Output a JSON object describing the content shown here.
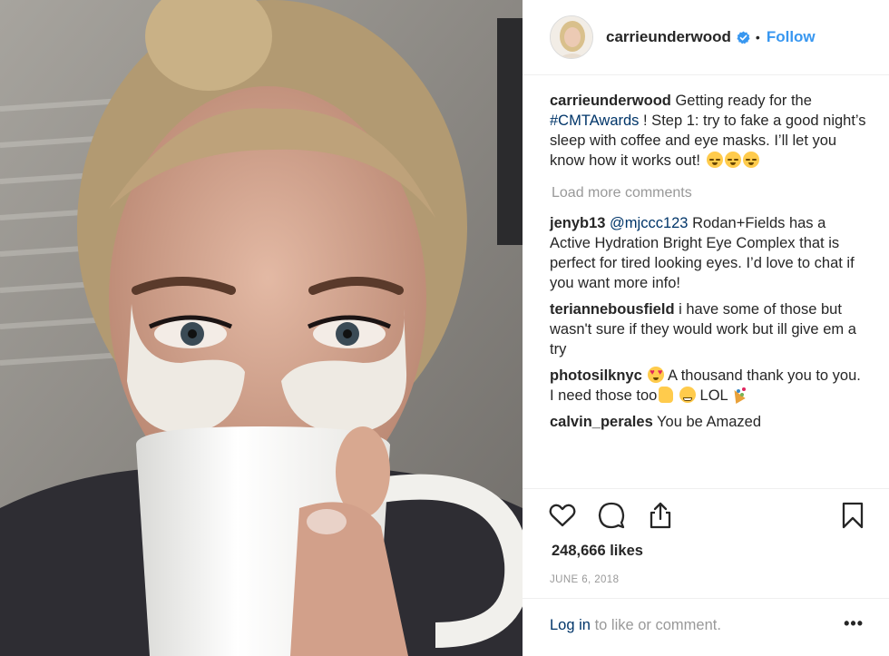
{
  "post": {
    "photo_description": "photo",
    "author": {
      "username": "carrieunderwood",
      "verified": true,
      "separator": "•",
      "follow_label": "Follow"
    },
    "caption": {
      "user": "carrieunderwood",
      "text_before": "Getting ready for the",
      "hashtag": "#CMTAwards",
      "text_after": "! Step 1: try to fake a good night’s sleep with coffee and eye masks. I’ll let you know how it works out!",
      "emojis": [
        "sleeping-face",
        "sleeping-face",
        "sleeping-face"
      ]
    },
    "load_more_label": "Load more comments",
    "comments": [
      {
        "user": "jenyb13",
        "mention": "@mjccc123",
        "text": "Rodan+Fields has a Active Hydration Bright Eye Complex that is perfect for tired looking eyes. I’d love to chat if you want more info!"
      },
      {
        "user": "teriannebousfield",
        "text": "i have some of those but wasn't sure if they would work but ill give em a try"
      },
      {
        "user": "photosilknyc",
        "emoji_before": "heart-eyes",
        "text": "A thousand thank you to you. I need those too",
        "emoji_mid": [
          "thumbs-up",
          "grinning-face"
        ],
        "text_after": "LOL",
        "emoji_after": "party-popper"
      },
      {
        "user": "calvin_perales",
        "text": "You be Amazed"
      }
    ],
    "likes_label": "248,666 likes",
    "date_label": "JUNE 6, 2018",
    "login": {
      "link_label": "Log in",
      "rest_label": "to like or comment.",
      "more_label": "•••"
    },
    "icons": {
      "like": "heart-icon",
      "comment": "comment-bubble-icon",
      "share": "share-icon",
      "save": "bookmark-icon"
    },
    "colors": {
      "accent": "#3897f0",
      "link": "#003569",
      "muted": "#999999",
      "text": "#262626",
      "verified": "#3897f0"
    }
  }
}
